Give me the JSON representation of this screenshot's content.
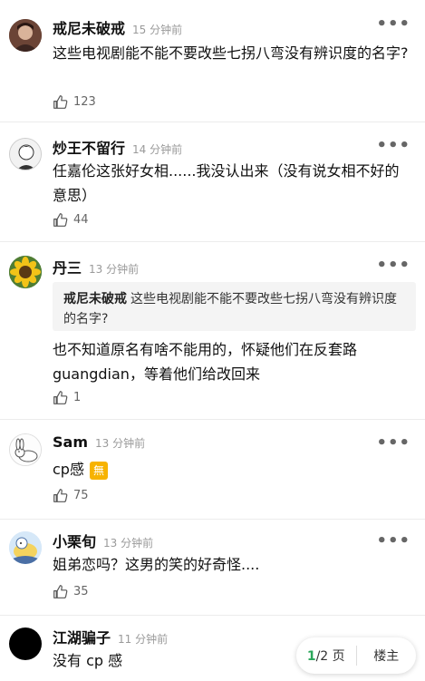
{
  "comments": [
    {
      "username": "戒尼未破戒",
      "time": "15 分钟前",
      "text": "这些电视剧能不能不要改些七拐八弯没有辨识度的名字?",
      "likes": "123",
      "avatar": "portrait-avatar"
    },
    {
      "username": "炒王不留行",
      "time": "14 分钟前",
      "text": "任嘉伦这张好女相......我没认出来（没有说女相不好的意思）",
      "likes": "44",
      "avatar": "sketch-man-avatar"
    },
    {
      "username": "丹三",
      "time": "13 分钟前",
      "quote_name": "戒尼未破戒",
      "quote_text": "这些电视剧能不能不要改些七拐八弯没有辨识度的名字?",
      "text": "也不知道原名有啥不能用的，怀疑他们在反套路guangdian，等着他们给改回来",
      "likes": "1",
      "avatar": "sunflower-avatar"
    },
    {
      "username": "Sam",
      "time": "13 分钟前",
      "text": "cp感",
      "badge": "無",
      "likes": "75",
      "avatar": "rabbit-avatar"
    },
    {
      "username": "小栗旬",
      "time": "13 分钟前",
      "text": "姐弟恋吗？这男的笑的好奇怪....",
      "likes": "35",
      "avatar": "cartoon-avatar"
    },
    {
      "username": "江湖骗子",
      "time": "11 分钟前",
      "text": "没有 cp 感",
      "likes": "",
      "avatar": "black-avatar"
    }
  ],
  "pager": {
    "current": "1",
    "total": "/2 页",
    "owner": "楼主"
  },
  "more_label": "•••"
}
